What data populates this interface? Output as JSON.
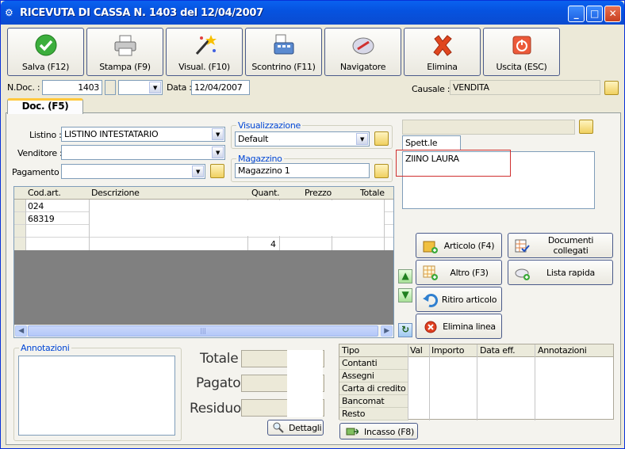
{
  "window": {
    "title": "RICEVUTA DI CASSA N. 1403  del 12/04/2007"
  },
  "toolbar": {
    "save": "Salva (F12)",
    "print": "Stampa (F9)",
    "view": "Visual. (F10)",
    "receipt": "Scontrino (F11)",
    "navigator": "Navigatore",
    "delete": "Elimina",
    "exit": "Uscita (ESC)"
  },
  "docbar": {
    "ndoc_label": "N.Doc. :",
    "ndoc_value": "1403",
    "data_label": "Data :",
    "data_value": "12/04/2007",
    "causale_label": "Causale :",
    "causale_value": "VENDITA"
  },
  "tab": {
    "label": "Doc. (F5)"
  },
  "form": {
    "listino_label": "Listino :",
    "listino_value": "LISTINO INTESTATARIO",
    "venditore_label": "Venditore :",
    "venditore_value": "",
    "pagamento_label": "Pagamento :",
    "pagamento_value": "",
    "visualizzazione_title": "Visualizzazione",
    "visualizzazione_value": "Default",
    "magazzino_title": "Magazzino",
    "magazzino_value": "Magazzino 1"
  },
  "customer": {
    "spett": "Spett.le",
    "name": "ZIINO LAURA"
  },
  "grid": {
    "columns": [
      "Cod.art.",
      "Descrizione",
      "Quant.",
      "Prezzo",
      "Totale"
    ],
    "rows": [
      {
        "code": "024",
        "qty": "",
        "price": "",
        "total": ""
      },
      {
        "code": "68319",
        "qty": "",
        "price": "",
        "total": ""
      },
      {
        "code": "",
        "qty": "",
        "price": "",
        "total": ""
      }
    ],
    "total_qty": "4"
  },
  "actions": {
    "articolo": "Articolo (F4)",
    "documenti": "Documenti collegati",
    "altro": "Altro (F3)",
    "lista": "Lista rapida",
    "ritiro": "Ritiro articolo",
    "elimina": "Elimina linea"
  },
  "notes": {
    "title": "Annotazioni"
  },
  "totals": {
    "totale": "Totale",
    "pagato": "Pagato",
    "residuo": "Residuo",
    "dettagli": "Dettagli"
  },
  "payments": {
    "columns": [
      "Tipo",
      "Val",
      "Importo",
      "Data eff.",
      "Annotazioni"
    ],
    "rows": [
      "Contanti",
      "Assegni",
      "Carta di credito",
      "Bancomat",
      "Resto"
    ],
    "incasso": "Incasso (F8)"
  },
  "colors": {
    "accent": "#0a56e6",
    "highlight_box": "#d03030",
    "tab_accent": "#ffc83c"
  }
}
